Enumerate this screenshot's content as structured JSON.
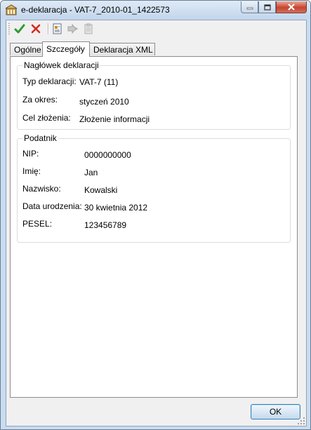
{
  "window": {
    "title": "e-deklaracja - VAT-7_2010-01_1422573"
  },
  "caption": {
    "min_icon": "minimize-icon",
    "max_icon": "maximize-icon",
    "close_icon": "close-icon"
  },
  "toolbar": {
    "items": [
      "checkmark-icon",
      "cancel-x-icon",
      "properties-icon",
      "forward-arrows-icon",
      "clipboard-icon"
    ]
  },
  "tabs": [
    {
      "label": "Ogólne",
      "active": false
    },
    {
      "label": "Szczegóły",
      "active": true
    },
    {
      "label": "Deklaracja XML",
      "active": false
    }
  ],
  "header_group": {
    "title": "Nagłówek deklaracji",
    "fields": [
      {
        "label": "Typ deklaracji:",
        "value": "VAT-7 (11)"
      },
      {
        "label": "Za okres:",
        "value": "styczeń 2010"
      },
      {
        "label": "Cel złożenia:",
        "value": "Złożenie informacji"
      }
    ]
  },
  "taxpayer_group": {
    "title": "Podatnik",
    "fields": [
      {
        "label": "NIP:",
        "value": "0000000000"
      },
      {
        "label": "Imię:",
        "value": "Jan"
      },
      {
        "label": "Nazwisko:",
        "value": "Kowalski"
      },
      {
        "label": "Data urodzenia:",
        "value": "30 kwietnia 2012"
      },
      {
        "label": "PESEL:",
        "value": "123456789"
      }
    ]
  },
  "footer": {
    "ok_label": "OK"
  },
  "colors": {
    "accent": "#3c7fb1",
    "close": "#c7432f",
    "check": "#2e9a2e",
    "cancel": "#d42b1e"
  }
}
